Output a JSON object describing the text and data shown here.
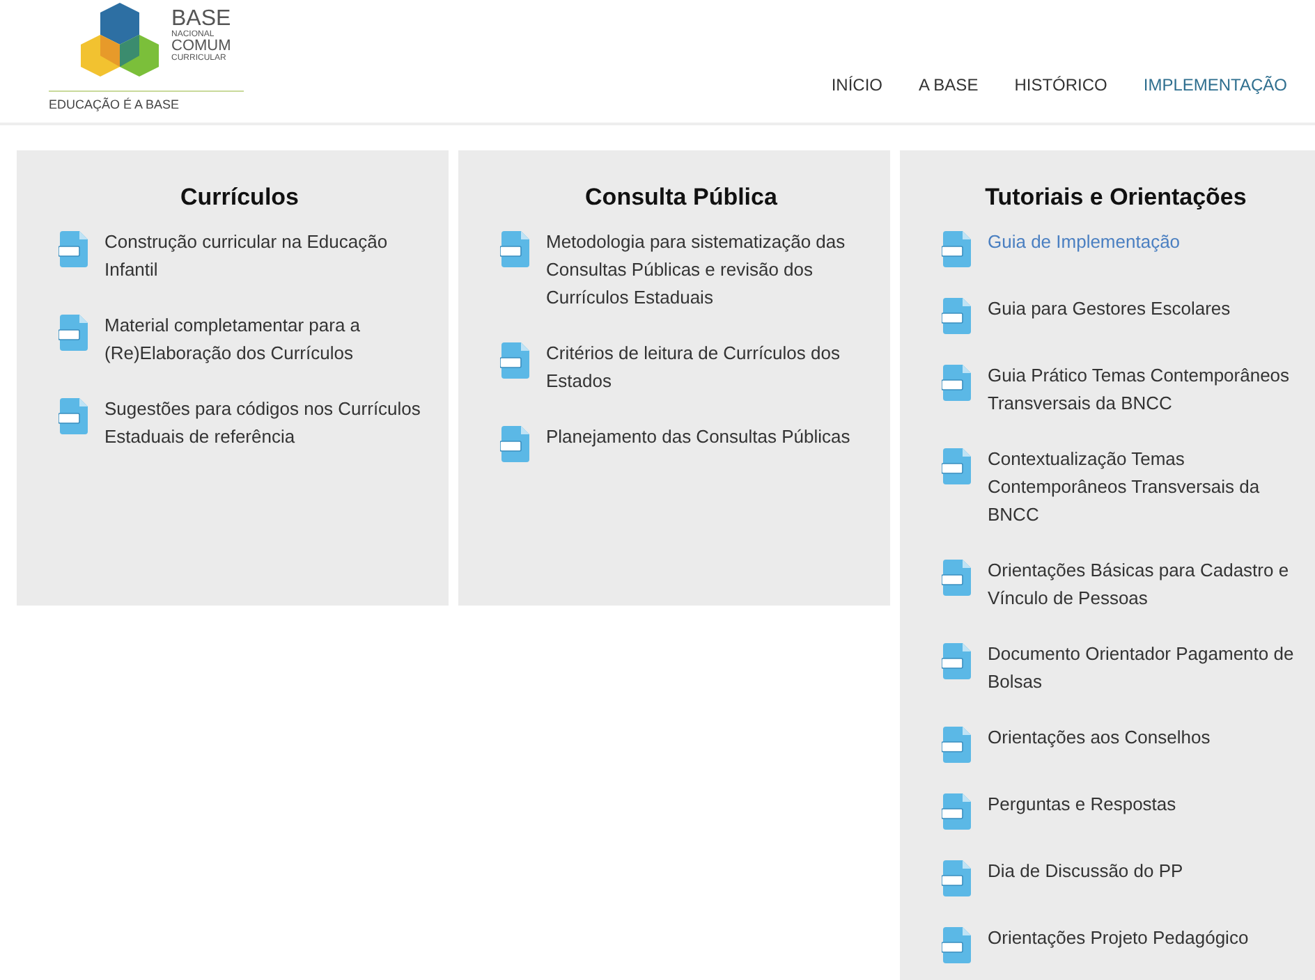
{
  "logo": {
    "title_lines": [
      "BASE",
      "NACIONAL",
      "COMUM",
      "CURRICULAR"
    ],
    "tagline": "EDUCAÇÃO É A BASE"
  },
  "nav": [
    {
      "label": "INÍCIO",
      "selected": false
    },
    {
      "label": "A BASE",
      "selected": false
    },
    {
      "label": "HISTÓRICO",
      "selected": false
    },
    {
      "label": "IMPLEMENTAÇÃO",
      "selected": true
    }
  ],
  "columns": [
    {
      "title": "Currículos",
      "items": [
        {
          "label": "Construção curricular na Educação Infantil",
          "selected": false
        },
        {
          "label": "Material completamentar para a (Re)Elaboração dos Currículos",
          "selected": false
        },
        {
          "label": "Sugestões para códigos nos Currículos Estaduais de referência",
          "selected": false
        }
      ]
    },
    {
      "title": "Consulta Pública",
      "items": [
        {
          "label": "Metodologia para sistematização das Consultas Públicas e revisão dos Currículos Estaduais",
          "selected": false
        },
        {
          "label": "Critérios de leitura de Currículos dos Estados",
          "selected": false
        },
        {
          "label": "Planejamento das Consultas Públicas",
          "selected": false
        }
      ]
    },
    {
      "title": "Tutoriais e Orientações",
      "items": [
        {
          "label": "Guia de Implementação",
          "selected": true
        },
        {
          "label": "Guia para Gestores Escolares",
          "selected": false
        },
        {
          "label": "Guia Prático Temas Contemporâneos Transversais da BNCC",
          "selected": false
        },
        {
          "label": "Contextualização Temas Contemporâneos Transversais da BNCC",
          "selected": false
        },
        {
          "label": "Orientações Básicas para Cadastro e Vínculo de Pessoas",
          "selected": false
        },
        {
          "label": "Documento Orientador Pagamento de Bolsas",
          "selected": false
        },
        {
          "label": "Orientações aos Conselhos",
          "selected": false
        },
        {
          "label": "Perguntas e Respostas",
          "selected": false
        },
        {
          "label": "Dia de Discussão do PP",
          "selected": false
        },
        {
          "label": "Orientações Projeto Pedagógico",
          "selected": false
        }
      ]
    }
  ]
}
